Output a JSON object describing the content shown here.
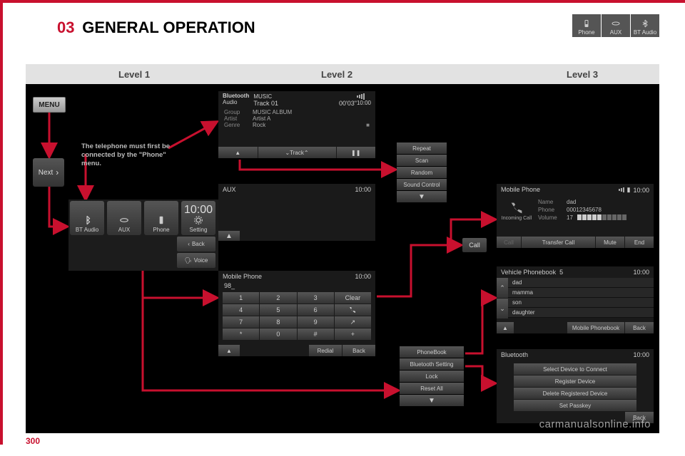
{
  "section": {
    "number": "03",
    "title": "GENERAL OPERATION"
  },
  "header_buttons": [
    {
      "label": "Phone",
      "icon": "phone-icon"
    },
    {
      "label": "AUX",
      "icon": "aux-icon"
    },
    {
      "label": "BT Audio",
      "icon": "bluetooth-icon"
    }
  ],
  "levels": {
    "l1": "Level 1",
    "l2": "Level 2",
    "l3": "Level 3"
  },
  "menu_label": "MENU",
  "next_label": "Next",
  "note_text": "The telephone must first be connected by the \"Phone\" menu.",
  "bt_music": {
    "head_top": "Bluetooth",
    "head_sub": "Audio",
    "track_label": "MUSIC",
    "track_name": "Track 01",
    "elapsed": "00'03\"",
    "clock": "10:00",
    "rows": [
      {
        "label": "Group",
        "value": "MUSIC ALBUM"
      },
      {
        "label": "Artist",
        "value": "Artist A"
      },
      {
        "label": "Genre",
        "value": "Rock"
      }
    ],
    "ctrl_track": "Track"
  },
  "option_list": [
    "Repeat",
    "Scan",
    "Random",
    "Sound Control"
  ],
  "main_screen": {
    "clock": "10:00",
    "tiles": [
      "BT Audio",
      "AUX",
      "Phone",
      "Setting"
    ],
    "side": {
      "back": "Back",
      "voice": "Voice"
    }
  },
  "aux": {
    "title": "AUX",
    "clock": "10:00"
  },
  "dial": {
    "title": "Mobile Phone",
    "clock": "10:00",
    "display": "98_",
    "keys": [
      "1",
      "2",
      "3",
      "Clear",
      "4",
      "5",
      "6",
      "",
      "7",
      "8",
      "9",
      "",
      "*",
      "0",
      "#",
      "+"
    ],
    "redial": "Redial",
    "back": "Back"
  },
  "call_label": "Call",
  "settings_list": [
    "PhoneBook",
    "Bluetooth Setting",
    "Lock",
    "Reset All"
  ],
  "incoming": {
    "title": "Mobile Phone",
    "clock": "10:00",
    "status": "Incoming Call",
    "name_label": "Name",
    "name": "dad",
    "phone_label": "Phone",
    "phone": "00012345678",
    "volume_label": "Volume",
    "volume_value": "17",
    "foot": {
      "call": "Call",
      "transfer": "Transfer Call",
      "mute": "Mute",
      "end": "End"
    }
  },
  "phonebook": {
    "title": "Vehicle Phonebook",
    "count": "5",
    "clock": "10:00",
    "items": [
      "dad",
      "mamma",
      "son",
      "daughter"
    ],
    "mobile_btn": "Mobile Phonebook",
    "back": "Back"
  },
  "btset": {
    "title": "Bluetooth",
    "clock": "10:00",
    "items": [
      "Select Device to Connect",
      "Register Device",
      "Delete Registered Device",
      "Set Passkey"
    ],
    "back": "Back"
  },
  "watermark": "carmanualsonline.info",
  "page_number": "300"
}
